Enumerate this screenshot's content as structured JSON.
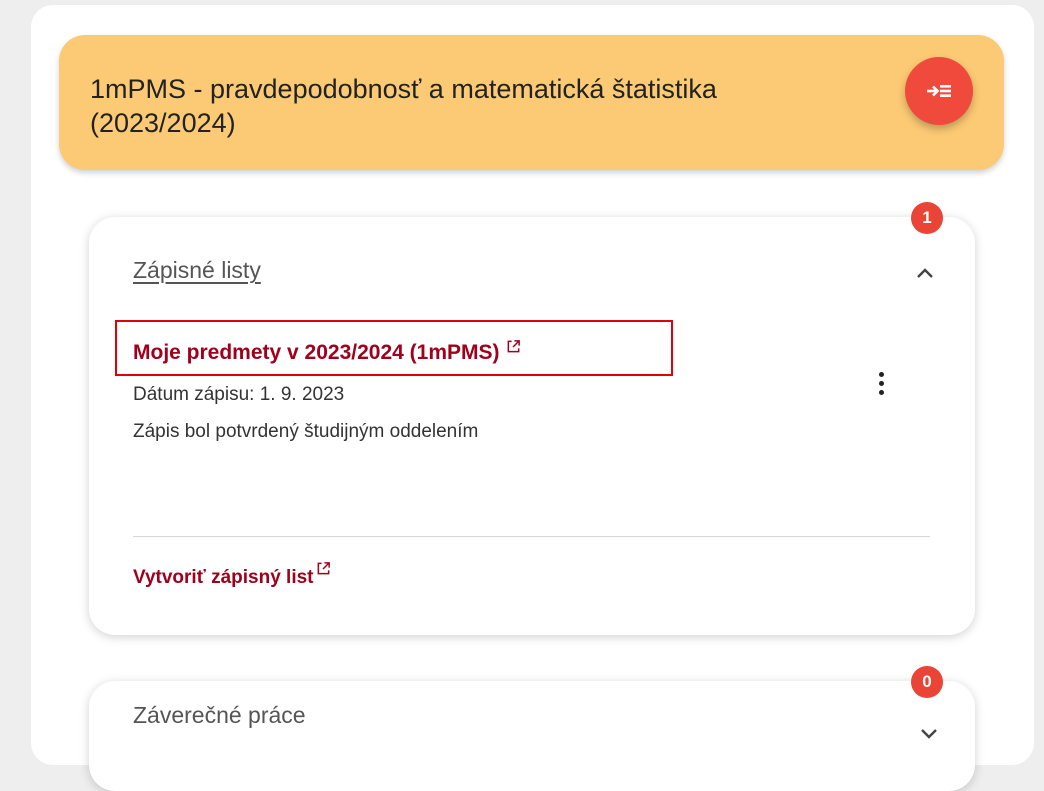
{
  "subject": {
    "title": "1mPMS - pravdepodobnosť a matematická štatistika (2023/2024)",
    "fab_icon": "collapse-panel-icon",
    "header_color": "#fcca74",
    "accent_color": "#f04a3c"
  },
  "enrollment_card": {
    "title": "Zápisné listy",
    "badge_count": "1",
    "expanded": true,
    "entry": {
      "link_text": "Moje predmety v 2023/2024 (1mPMS)",
      "date_line": "Dátum zápisu: 1. 9. 2023",
      "status_line": "Zápis bol potvrdený študijným oddelením",
      "menu_icon": "kebab-menu-icon",
      "link_icon": "external-link-icon"
    },
    "create_link": "Vytvoriť zápisný list",
    "link_color": "#a0001c"
  },
  "thesis_card": {
    "title": "Záverečné práce",
    "badge_count": "0",
    "expanded": false
  }
}
